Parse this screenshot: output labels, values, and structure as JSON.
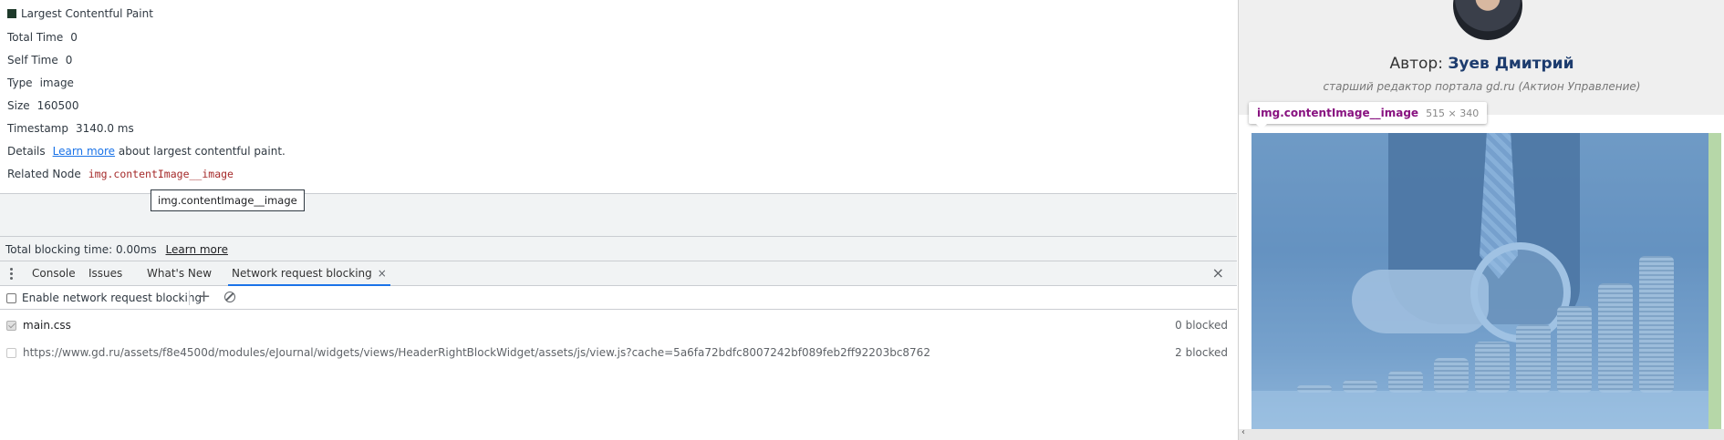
{
  "details": {
    "title": "Largest Contentful Paint",
    "total_time_label": "Total Time",
    "total_time_value": "0",
    "self_time_label": "Self Time",
    "self_time_value": "0",
    "type_label": "Type",
    "type_value": "image",
    "size_label": "Size",
    "size_value": "160500",
    "timestamp_label": "Timestamp",
    "timestamp_value": "3140.0 ms",
    "details_label": "Details",
    "details_link": "Learn more",
    "details_text": " about largest contentful paint.",
    "related_node_label": "Related Node",
    "related_node_value": "img.contentImage__image",
    "tooltip": "img.contentImage__image"
  },
  "summary": {
    "total_blocking_time": "Total blocking time: 0.00ms",
    "learn_more": "Learn more"
  },
  "drawer": {
    "tabs": [
      {
        "label": "Console"
      },
      {
        "label": "Issues"
      },
      {
        "label": "What's New"
      },
      {
        "label": "Network request blocking"
      }
    ],
    "close_icon": "×"
  },
  "toolbar": {
    "enable_label": "Enable network request blocking",
    "add_icon": "+",
    "enabled": false
  },
  "requests": [
    {
      "url": "main.css",
      "count": "0 blocked",
      "checked": true
    },
    {
      "url": "https://www.gd.ru/assets/f8e4500d/modules/eJournal/widgets/views/HeaderRightBlockWidget/assets/js/view.js?cache=5a6fa72bdfc8007242bf089feb2ff92203bc8762",
      "count": "2 blocked",
      "checked": false
    }
  ],
  "page": {
    "author_prefix": "Автор: ",
    "author_name": "Зуев Дмитрий",
    "author_role": "старший редактор портала gd.ru (Актион Управление)",
    "element_tag": "img.contentImage__image",
    "element_size": "515 × 340",
    "scroll_left_icon": "‹"
  },
  "colors": {
    "link": "#1a73e8",
    "node": "#a52a2a",
    "active_tab": "#1a73e8",
    "highlight_overlay": "#6fa8dc",
    "element_tag": "#881280"
  }
}
